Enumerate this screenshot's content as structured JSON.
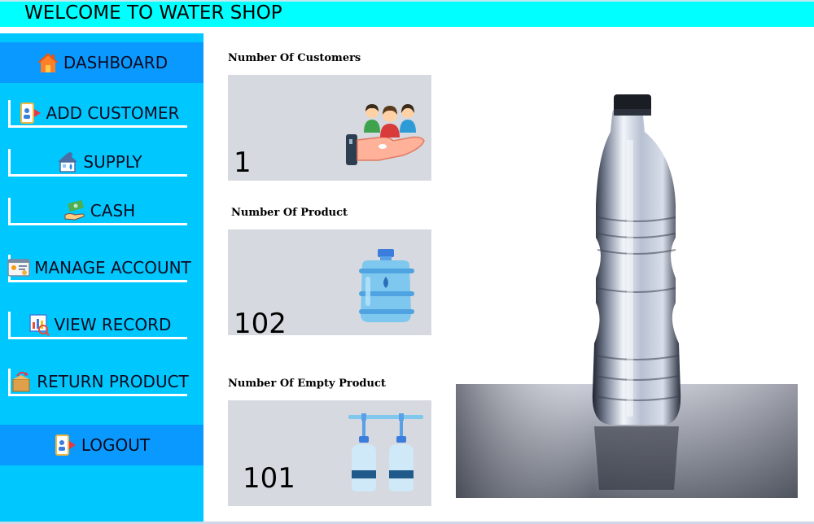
{
  "header": {
    "title": "WELCOME TO WATER SHOP"
  },
  "sidebar": {
    "items": [
      {
        "label": "DASHBOARD",
        "icon": "home-icon",
        "active": true
      },
      {
        "label": "ADD CUSTOMER",
        "icon": "add-customer-icon"
      },
      {
        "label": "SUPPLY",
        "icon": "supply-icon"
      },
      {
        "label": "CASH",
        "icon": "cash-icon"
      },
      {
        "label": "MANAGE ACCOUNT",
        "icon": "manage-account-icon"
      },
      {
        "label": "VIEW RECORD",
        "icon": "view-record-icon"
      },
      {
        "label": "RETURN PRODUCT",
        "icon": "return-product-icon"
      },
      {
        "label": "LOGOUT",
        "icon": "logout-icon",
        "highlight": true
      }
    ]
  },
  "cards": [
    {
      "label": "Number Of Customers",
      "count": "1",
      "icon": "customers-hand-icon"
    },
    {
      "label": "Number Of Product",
      "count": "102",
      "icon": "water-jug-icon"
    },
    {
      "label": "Number Of Empty Product",
      "count": "101",
      "icon": "empty-bottles-icon"
    }
  ],
  "photo": {
    "icon": "water-bottle-photo"
  },
  "colors": {
    "header_bg": "#00ffff",
    "sidebar_bg": "#00c8ff",
    "active_bg": "#0a9aff",
    "card_bg": "#d6d9df"
  }
}
